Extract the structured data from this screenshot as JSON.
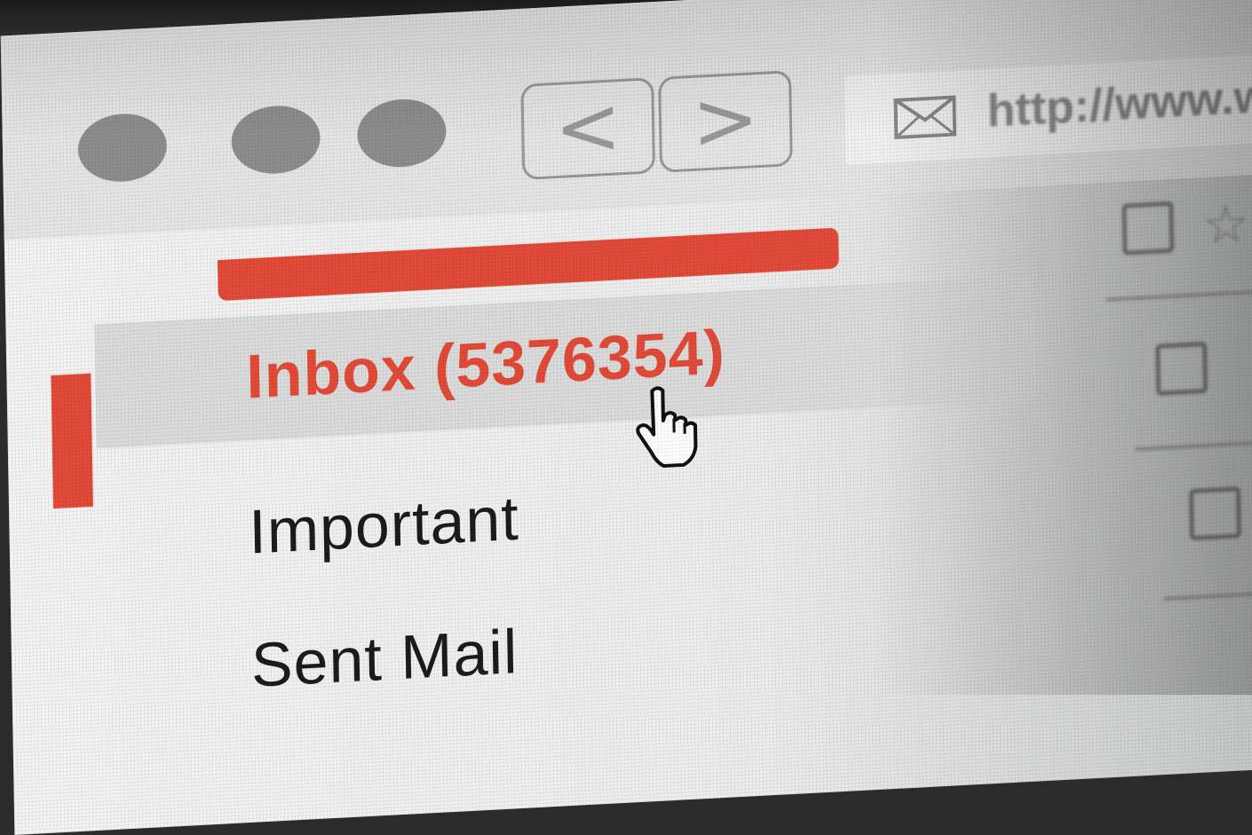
{
  "browser": {
    "url": "http://www.w/",
    "back_symbol": "<",
    "forward_symbol": ">",
    "mail_icon": "envelope-icon",
    "window_dots": [
      "dot",
      "dot",
      "dot"
    ]
  },
  "sidebar": {
    "compose_bar_color": "#e34b38",
    "items": [
      {
        "label": "Inbox (5376354)",
        "active": true
      },
      {
        "label": "Important",
        "active": false
      },
      {
        "label": "Sent Mail",
        "active": false
      }
    ]
  },
  "cursor": {
    "icon": "hand-pointer-icon"
  },
  "message_list": {
    "star_icon": "☆",
    "rows": [
      {
        "checkbox": "unchecked"
      },
      {
        "checkbox": "unchecked"
      },
      {
        "checkbox": "unchecked"
      }
    ]
  },
  "colors": {
    "accent": "#e34b38",
    "text": "#1c1c1c",
    "chrome": "#e6e6e6"
  }
}
